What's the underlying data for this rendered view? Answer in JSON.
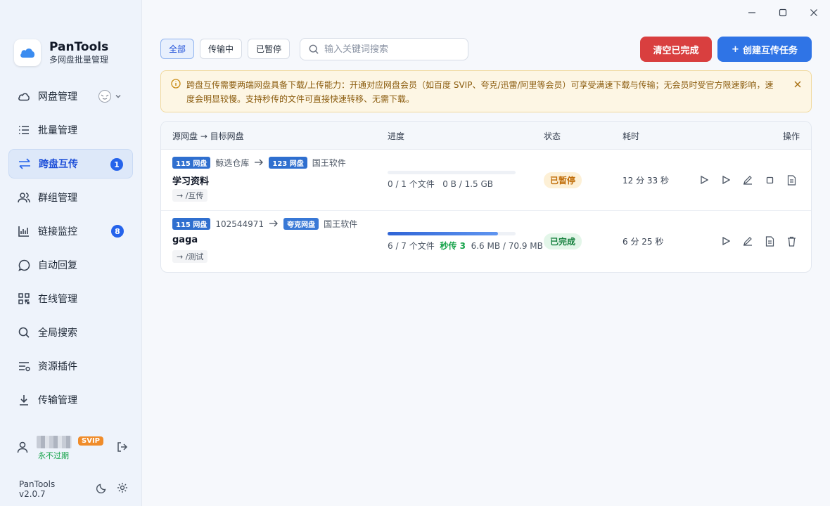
{
  "app": {
    "name": "PanTools",
    "subtitle": "多网盘批量管理",
    "version": "PanTools v2.0.7"
  },
  "sidebar": {
    "items": [
      {
        "label": "网盘管理",
        "icon": "cloud-icon"
      },
      {
        "label": "批量管理",
        "icon": "list-icon"
      },
      {
        "label": "跨盘互传",
        "icon": "transfer-icon",
        "badge": "1",
        "active": true
      },
      {
        "label": "群组管理",
        "icon": "users-icon"
      },
      {
        "label": "链接监控",
        "icon": "chart-icon",
        "badge": "8"
      },
      {
        "label": "自动回复",
        "icon": "chat-icon"
      },
      {
        "label": "在线管理",
        "icon": "qr-icon"
      },
      {
        "label": "全局搜索",
        "icon": "search-icon"
      },
      {
        "label": "资源插件",
        "icon": "plugin-icon"
      },
      {
        "label": "传输管理",
        "icon": "download-icon"
      }
    ]
  },
  "user": {
    "badge": "SVIP",
    "expire": "永不过期"
  },
  "filters": [
    {
      "label": "全部"
    },
    {
      "label": "传输中"
    },
    {
      "label": "已暂停"
    }
  ],
  "search": {
    "placeholder": "输入关键词搜索"
  },
  "actions": {
    "clear": "清空已完成",
    "create": "创建互传任务",
    "create_prefix": "+"
  },
  "notice": {
    "text": "跨盘互传需要两端网盘具备下载/上传能力：开通对应网盘会员（如百度 SVIP、夸克/迅雷/阿里等会员）可享受满速下载与传输；无会员时受官方限速影响，速度会明显较慢。支持秒传的文件可直接快速转移、无需下载。"
  },
  "table": {
    "headers": {
      "route": "源网盘 → 目标网盘",
      "progress": "进度",
      "status": "状态",
      "elapsed": "耗时",
      "ops": "操作"
    },
    "rows": [
      {
        "src_tag": "115 网盘",
        "src_name": "鲸选仓库",
        "dst_tag": "123 网盘",
        "dst_name": "国王软件",
        "name": "学习资料",
        "path": "→ /互传",
        "progress": 0,
        "files": "0 / 1 个文件",
        "instant": "",
        "size": "0 B / 1.5 GB",
        "status": "已暂停",
        "elapsed": "12 分 33 秒"
      },
      {
        "src_tag": "115 网盘",
        "src_name": "102544971",
        "dst_tag": "夸克网盘",
        "dst_name": "国王软件",
        "name": "gaga",
        "path": "→ /测试",
        "progress": 0.86,
        "files": "6 / 7 个文件",
        "instant": "秒传 3",
        "size": "6.6 MB / 70.9 MB",
        "status": "已完成",
        "elapsed": "6 分 25 秒"
      }
    ]
  }
}
